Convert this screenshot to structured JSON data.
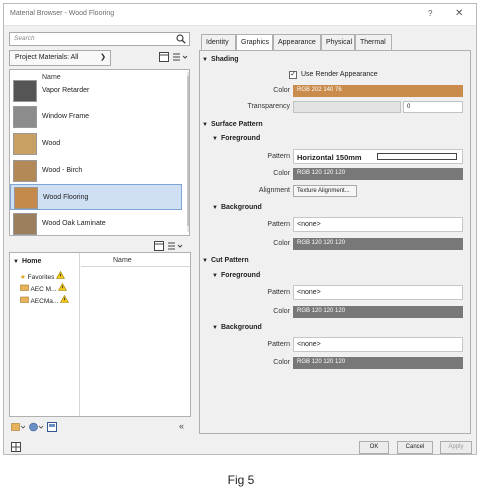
{
  "window": {
    "title": "Material Browser - Wood Flooring",
    "help": "?",
    "close": "✕"
  },
  "search": {
    "placeholder": "Search"
  },
  "library_dropdown": {
    "label": "Project Materials: All",
    "chevron": "❯"
  },
  "material_list": {
    "column_header": "Name",
    "items": [
      {
        "label": "Vapor Retarder",
        "swatch": "#555555"
      },
      {
        "label": "Window Frame",
        "swatch": "#8c8c8c"
      },
      {
        "label": "Wood",
        "swatch": "#c9a064"
      },
      {
        "label": "Wood - Birch",
        "swatch": "#b38a57"
      },
      {
        "label": "Wood Flooring",
        "swatch": "#c48a4c",
        "selected": true
      },
      {
        "label": "Wood Oak Laminate",
        "swatch": "#9c7f5d"
      }
    ]
  },
  "library_tree": {
    "home_label": "Home",
    "column_header": "Name",
    "items": [
      {
        "label": "Favorites"
      },
      {
        "label": "AEC M..."
      },
      {
        "label": "AECMa..."
      }
    ]
  },
  "tabs": [
    {
      "label": "Identity"
    },
    {
      "label": "Graphics",
      "active": true
    },
    {
      "label": "Appearance"
    },
    {
      "label": "Physical"
    },
    {
      "label": "Thermal"
    }
  ],
  "shading": {
    "heading": "Shading",
    "use_render_label": "Use Render Appearance",
    "color_label": "Color",
    "color_value": "RGB 202 140 76",
    "color_hex": "#ca8c4c",
    "transparency_label": "Transparency",
    "transparency_value": "0"
  },
  "surface_pattern": {
    "heading": "Surface Pattern",
    "foreground": {
      "heading": "Foreground",
      "pattern_label": "Pattern",
      "pattern_value": "Horizontal 150mm",
      "color_label": "Color",
      "color_value": "RGB 120 120 120",
      "alignment_label": "Alignment",
      "alignment_button": "Texture Alignment..."
    },
    "background": {
      "heading": "Background",
      "pattern_label": "Pattern",
      "pattern_value": "<none>",
      "color_label": "Color",
      "color_value": "RGB 120 120 120"
    }
  },
  "cut_pattern": {
    "heading": "Cut Pattern",
    "foreground": {
      "heading": "Foreground",
      "pattern_label": "Pattern",
      "pattern_value": "<none>",
      "color_label": "Color",
      "color_value": "RGB 120 120 120"
    },
    "background": {
      "heading": "Background",
      "pattern_label": "Pattern",
      "pattern_value": "<none>",
      "color_label": "Color",
      "color_value": "RGB 120 120 120"
    }
  },
  "gray_hex": "#787878",
  "buttons": {
    "ok": "OK",
    "cancel": "Cancel",
    "apply": "Apply"
  },
  "collapse_label": "«",
  "caption": "Fig 5"
}
